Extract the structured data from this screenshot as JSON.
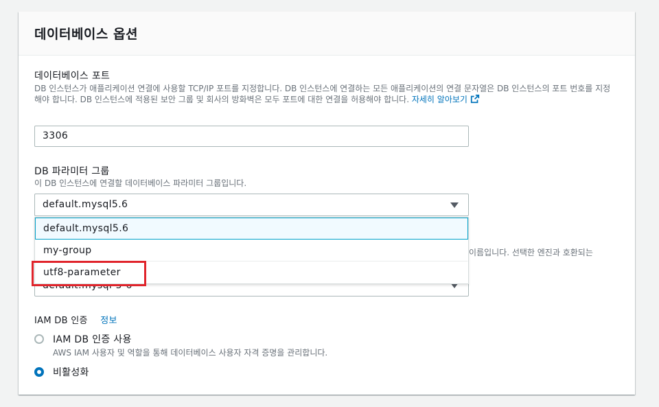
{
  "section": {
    "title": "데이터베이스 옵션"
  },
  "port": {
    "label": "데이터베이스 포트",
    "description": "DB 인스턴스가 애플리케이션 연결에 사용할 TCP/IP 포트를 지정합니다. DB 인스턴스에 연결하는 모든 애플리케이션의 연결 문자열은 DB 인스턴스의 포트 번호를 지정해야 합니다. DB 인스턴스에 적용된 보안 그룹 및 회사의 방화벽은 모두 포트에 대한 연결을 허용해야 합니다.",
    "learn_more": "자세히 알아보기",
    "value": "3306"
  },
  "parameter_group": {
    "label": "DB 파라미터 그룹",
    "description": "이 DB 인스턴스에 연결할 데이터베이스 파라미터 그룹입니다.",
    "selected": "default.mysql5.6",
    "options": [
      "default.mysql5.6",
      "my-group",
      "utf8-parameter"
    ]
  },
  "option_group": {
    "partial_description": "이름입니다. 선택한 엔진과 호환되는",
    "partial_value": "default:mysql-5-6"
  },
  "iam_auth": {
    "label": "IAM DB 인증",
    "info": "정보",
    "enable_label": "IAM DB 인증 사용",
    "enable_description": "AWS IAM 사용자 및 역할을 통해 데이터베이스 사용자 자격 증명을 관리합니다.",
    "disable_label": "비활성화"
  },
  "colors": {
    "link": "#0073bb",
    "highlight": "#e0242b",
    "selected_bg": "#f1faff",
    "selected_border": "#00a1c9"
  }
}
